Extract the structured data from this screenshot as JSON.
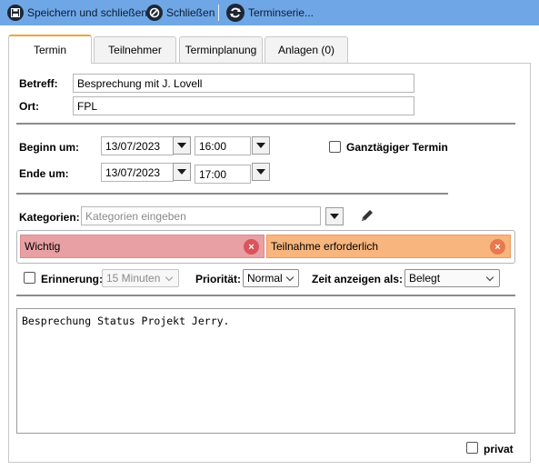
{
  "toolbar": {
    "save_close": "Speichern und schließen",
    "close": "Schließen",
    "series": "Terminserie..."
  },
  "tabs": [
    "Termin",
    "Teilnehmer",
    "Terminplanung",
    "Anlagen (0)"
  ],
  "form": {
    "subject_label": "Betreff:",
    "subject_value": "Besprechung mit J. Lovell",
    "location_label": "Ort:",
    "location_value": "FPL",
    "start_label": "Beginn um:",
    "start_date": "13/07/2023",
    "start_time": "16:00",
    "end_label": "Ende um:",
    "end_date": "13/07/2023",
    "end_time": "17:00",
    "allday_label": "Ganztägiger Termin",
    "categories_label": "Kategorien:",
    "categories_placeholder": "Kategorien eingeben",
    "tags": [
      {
        "label": "Wichtig",
        "color": "#e8a0a4",
        "border": "#d98a8f",
        "x_color": "#d9545d"
      },
      {
        "label": "Teilnahme erforderlich",
        "color": "#f8b57e",
        "border": "#e89b5c",
        "x_color": "#e8794e"
      }
    ],
    "reminder_label": "Erinnerung:",
    "reminder_value": "15 Minuten",
    "priority_label": "Priorität:",
    "priority_value": "Normal",
    "showas_label": "Zeit anzeigen als:",
    "showas_value": "Belegt",
    "body_text": "Besprechung Status Projekt Jerry.",
    "private_label": "privat"
  },
  "icons": [
    "save-icon",
    "close-icon",
    "recurrence-icon",
    "pencil-icon",
    "remove-tag-icon"
  ],
  "colors": {
    "toolbar_bg": "#6fa7e6",
    "active_tab_accent": "#f0a43a"
  }
}
